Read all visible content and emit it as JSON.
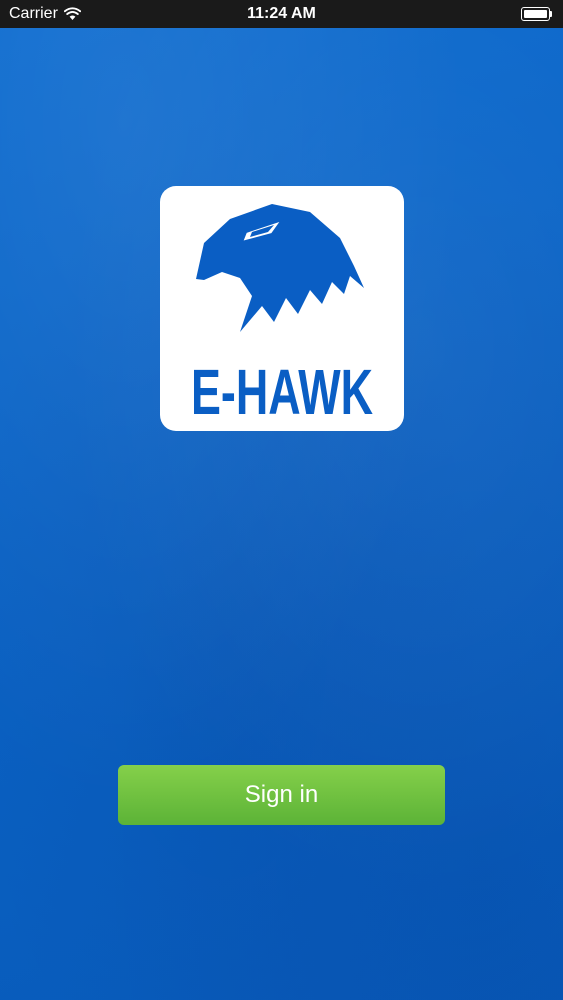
{
  "status_bar": {
    "carrier": "Carrier",
    "time": "11:24 AM",
    "battery_level": 1.0
  },
  "logo": {
    "text": "E-HAWK",
    "icon": "eagle-head-logo",
    "color": "#0a5ec4"
  },
  "actions": {
    "sign_in_label": "Sign in"
  },
  "colors": {
    "background": "#0a63c6",
    "button": "#6dc13f",
    "status_bar": "#1a1a1a"
  }
}
